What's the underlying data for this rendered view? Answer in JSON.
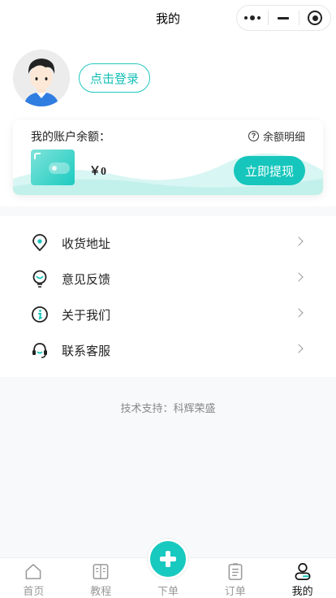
{
  "navbar": {
    "title": "我的"
  },
  "header": {
    "login_label": "点击登录",
    "balance": {
      "label": "我的账户余额：",
      "detail_label": "余额明细",
      "amount": "￥0",
      "withdraw_label": "立即提现"
    }
  },
  "menu": {
    "items": [
      {
        "label": "收货地址",
        "icon": "location-pin-icon"
      },
      {
        "label": "意见反馈",
        "icon": "feedback-bulb-icon"
      },
      {
        "label": "关于我们",
        "icon": "info-icon"
      },
      {
        "label": "联系客服",
        "icon": "headset-icon"
      }
    ]
  },
  "footer": {
    "support_text": "技术支持：科辉荣盛"
  },
  "tabbar": {
    "tabs": [
      {
        "label": "首页",
        "icon": "home-icon"
      },
      {
        "label": "教程",
        "icon": "book-icon"
      },
      {
        "label": "下单",
        "icon": "plus-icon"
      },
      {
        "label": "订单",
        "icon": "order-list-icon"
      },
      {
        "label": "我的",
        "icon": "user-icon",
        "active": true
      }
    ]
  },
  "colors": {
    "accent": "#16c6bc",
    "page_bg": "#f7f9fa"
  }
}
